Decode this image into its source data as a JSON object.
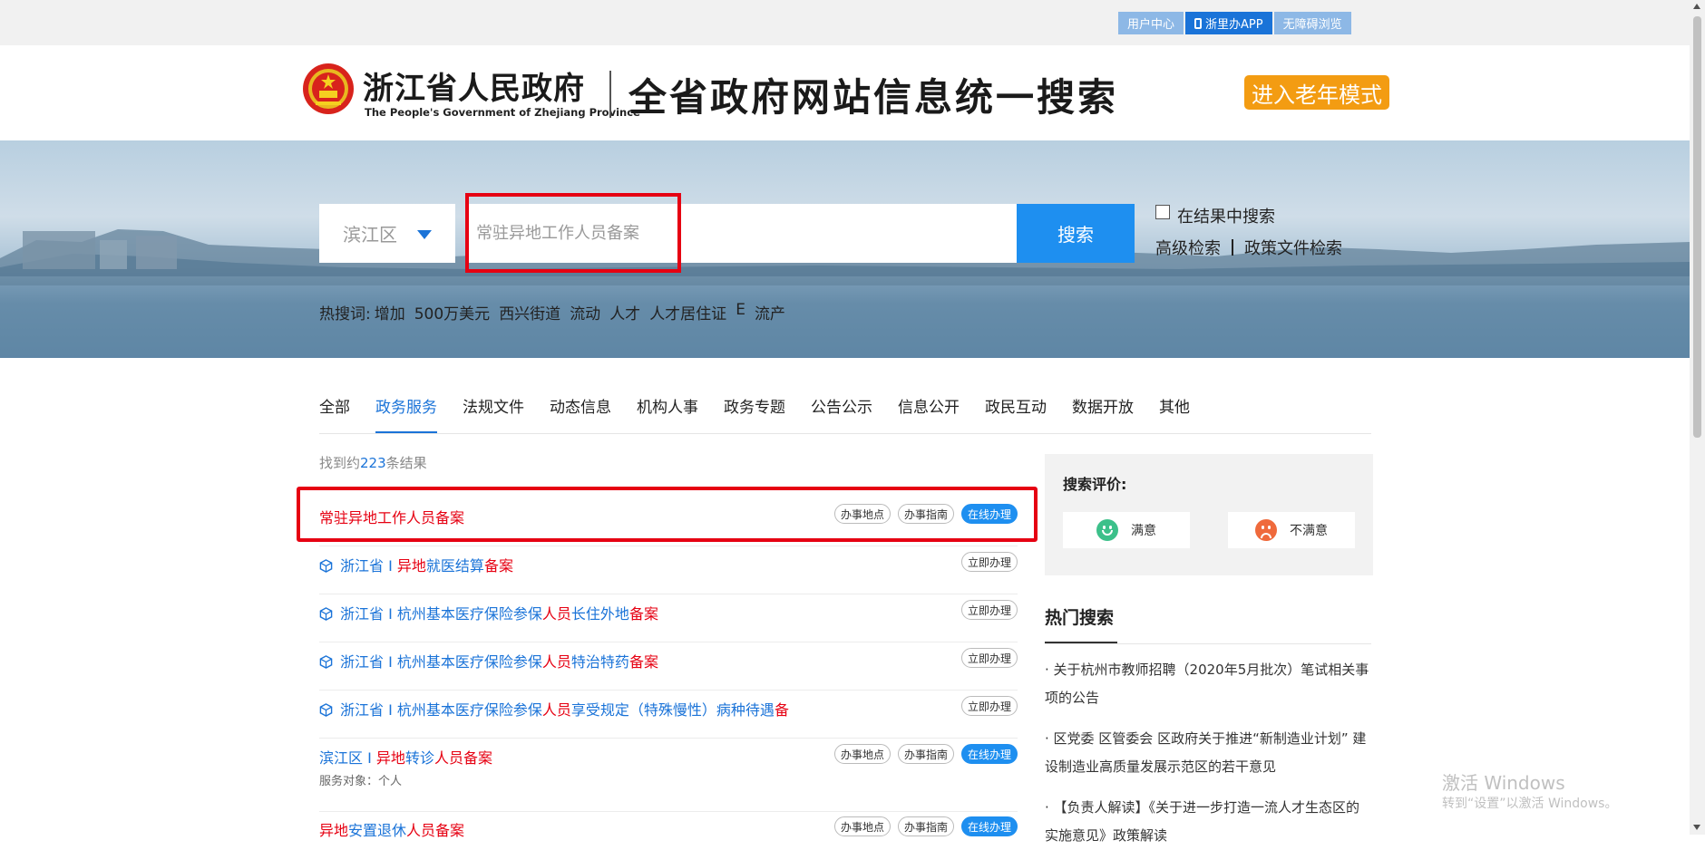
{
  "top_links": [
    {
      "label": "用户中心",
      "icon": ""
    },
    {
      "label": "浙里办APP",
      "icon": "phone-icon"
    },
    {
      "label": "无障碍浏览",
      "icon": ""
    }
  ],
  "header": {
    "site_title": "浙江省人民政府",
    "site_subtitle": "The People's Government of Zhejiang Province",
    "page_heading": "全省政府网站信息统一搜索",
    "elder_mode": "进入老年模式",
    "emblem_icon": "national-emblem-icon"
  },
  "search": {
    "region": "滨江区",
    "query": "常驻异地工作人员备案",
    "button": "搜索",
    "within_results": "在结果中搜索",
    "advanced": "高级检索",
    "policy_search": "政策文件检索"
  },
  "hotwords": {
    "label": "热搜词:",
    "items": [
      "增加",
      "500万美元",
      "西兴街道",
      "流动",
      "人才",
      "人才居住证",
      "E",
      "流产"
    ]
  },
  "tabs": [
    "全部",
    "政务服务",
    "法规文件",
    "动态信息",
    "机构人事",
    "政务专题",
    "公告公示",
    "信息公开",
    "政民互动",
    "数据开放",
    "其他"
  ],
  "active_tab": "政务服务",
  "result_count": {
    "prefix": "找到约",
    "count": "223",
    "suffix": "条结果"
  },
  "results": [
    {
      "segments": [
        {
          "t": "常驻异地工作人员备案",
          "red": true
        }
      ],
      "buttons": [
        "办事地点",
        "办事指南",
        "在线办理"
      ],
      "meta": ""
    },
    {
      "segments": [
        {
          "t": "浙江省 I ",
          "red": false
        },
        {
          "t": "异地",
          "red": true
        },
        {
          "t": "就医结算",
          "red": false
        },
        {
          "t": "备案",
          "red": true
        }
      ],
      "buttons": [
        "立即办理"
      ],
      "icon": "service-cube-icon",
      "meta": ""
    },
    {
      "segments": [
        {
          "t": "浙江省 I 杭州基本医疗保险参保",
          "red": false
        },
        {
          "t": "人员",
          "red": true
        },
        {
          "t": "长住外地",
          "red": false
        },
        {
          "t": "备案",
          "red": true
        }
      ],
      "buttons": [
        "立即办理"
      ],
      "icon": "service-cube-icon",
      "meta": ""
    },
    {
      "segments": [
        {
          "t": "浙江省 I 杭州基本医疗保险参保",
          "red": false
        },
        {
          "t": "人员",
          "red": true
        },
        {
          "t": "特治特药",
          "red": false
        },
        {
          "t": "备案",
          "red": true
        }
      ],
      "buttons": [
        "立即办理"
      ],
      "icon": "service-cube-icon",
      "meta": ""
    },
    {
      "segments": [
        {
          "t": "浙江省 I 杭州基本医疗保险参保",
          "red": false
        },
        {
          "t": "人员",
          "red": true
        },
        {
          "t": "享受规定（特殊慢性）病种待遇",
          "red": false
        },
        {
          "t": "备",
          "red": true
        }
      ],
      "buttons": [
        "立即办理"
      ],
      "icon": "service-cube-icon",
      "meta": ""
    },
    {
      "segments": [
        {
          "t": "滨江区 I ",
          "red": false
        },
        {
          "t": "异地",
          "red": true
        },
        {
          "t": "转诊",
          "red": false
        },
        {
          "t": "人员备案",
          "red": true
        }
      ],
      "buttons": [
        "办事地点",
        "办事指南",
        "在线办理"
      ],
      "meta": "服务对象：个人"
    },
    {
      "segments": [
        {
          "t": "异地",
          "red": true
        },
        {
          "t": "安置退休",
          "red": false
        },
        {
          "t": "人员备案",
          "red": true
        }
      ],
      "buttons": [
        "办事地点",
        "办事指南",
        "在线办理"
      ],
      "meta": ""
    }
  ],
  "evaluation": {
    "title": "搜索评价:",
    "good": "满意",
    "bad": "不满意"
  },
  "hot_search": {
    "title": "热门搜索",
    "items": [
      "· 关于杭州市教师招聘（2020年5月批次）笔试相关事项的公告",
      "· 区党委 区管委会 区政府关于推进“新制造业计划” 建设制造业高质量发展示范区的若干意见",
      "· 【负责人解读】《关于进一步打造一流人才生态区的实施意见》政策解读"
    ]
  },
  "watermark": {
    "line1": "激活 Windows",
    "line2": "转到“设置”以激活 Windows。"
  },
  "colors": {
    "accent": "#1a73d8",
    "highlight": "#e60012",
    "elder": "#f39c12"
  }
}
